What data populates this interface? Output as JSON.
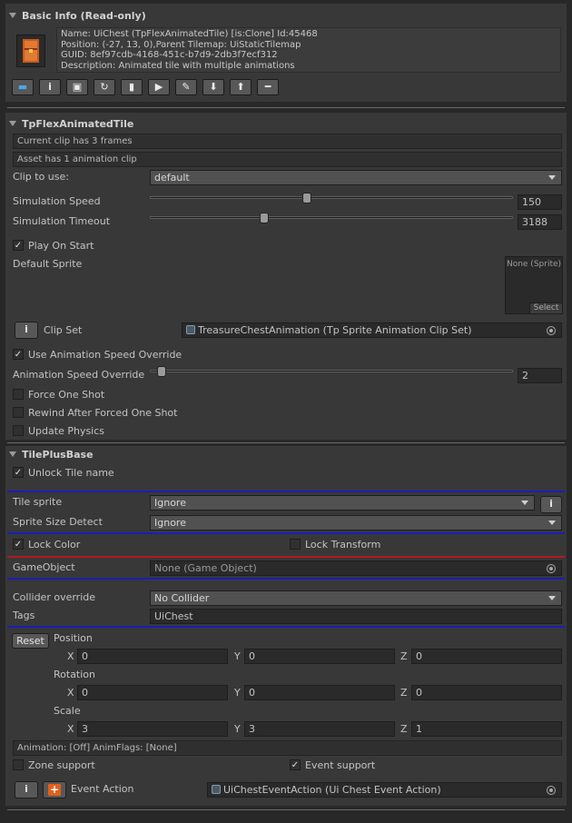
{
  "basic_info": {
    "title": "Basic Info (Read-only)",
    "name_line": "Name: UiChest (TpFlexAnimatedTile) [is:Clone] Id:45468",
    "position_line": "Position: (-27, 13, 0),Parent Tilemap: UiStaticTilemap",
    "guid_line": "GUID: 8ef97cdb-4168-451c-b7d9-2db3f7ecf312",
    "desc_line": "Description: Animated tile with multiple animations",
    "toolbar": [
      {
        "name": "camera-icon",
        "glyph": "▬"
      },
      {
        "name": "info-icon",
        "glyph": "i"
      },
      {
        "name": "save-icon",
        "glyph": "▣"
      },
      {
        "name": "refresh-icon",
        "glyph": "↻"
      },
      {
        "name": "clipboard-icon",
        "glyph": "▮"
      },
      {
        "name": "play-icon",
        "glyph": "▶"
      },
      {
        "name": "eyedropper-icon",
        "glyph": "✎"
      },
      {
        "name": "arrow-down-icon",
        "glyph": "⬇"
      },
      {
        "name": "arrow-up-icon",
        "glyph": "⬆"
      },
      {
        "name": "minus-icon",
        "glyph": "━"
      }
    ]
  },
  "flex": {
    "title": "TpFlexAnimatedTile",
    "info1": "Current clip has 3 frames",
    "info2": "Asset has 1 animation clip",
    "clip_label": "Clip to use:",
    "clip_value": "default",
    "sim_speed_label": "Simulation Speed",
    "sim_speed_value": "150",
    "sim_speed_fraction": 0.43,
    "sim_timeout_label": "Simulation Timeout",
    "sim_timeout_value": "3188",
    "sim_timeout_fraction": 0.31,
    "play_on_start": "Play On Start",
    "default_sprite_label": "Default Sprite",
    "sprite_none": "None (Sprite)",
    "sprite_select": "Select",
    "clip_set_label": "Clip Set",
    "clip_set_value": "TreasureChestAnimation (Tp Sprite Animation Clip Set)",
    "use_override": "Use Animation Speed Override",
    "anim_override_label": "Animation Speed Override",
    "anim_override_value": "2",
    "anim_override_fraction": 0.02,
    "force_one_shot": "Force One Shot",
    "rewind": "Rewind After Forced One Shot",
    "update_physics": "Update Physics"
  },
  "base": {
    "title": "TilePlusBase",
    "unlock_name": "Unlock Tile name",
    "tile_sprite_label": "Tile sprite",
    "tile_sprite_value": "Ignore",
    "size_detect_label": "Sprite Size Detect",
    "size_detect_value": "Ignore",
    "lock_color": "Lock Color",
    "lock_transform": "Lock Transform",
    "gameobject_label": "GameObject",
    "gameobject_value": "None (Game Object)",
    "collider_label": "Collider override",
    "collider_value": "No Collider",
    "tags_label": "Tags",
    "tags_value": "UiChest",
    "reset": "Reset",
    "position_label": "Position",
    "rotation_label": "Rotation",
    "scale_label": "Scale",
    "x": "X",
    "y": "Y",
    "z": "Z",
    "pos": [
      "0",
      "0",
      "0"
    ],
    "rot": [
      "0",
      "0",
      "0"
    ],
    "scl": [
      "3",
      "3",
      "1"
    ],
    "anim_flags": "Animation: [Off] AnimFlags: [None]",
    "zone_support": "Zone support",
    "event_support": "Event support",
    "event_action_label": "Event Action",
    "event_action_value": "UiChestEventAction (Ui Chest Event Action)"
  },
  "colors": {
    "background": "#282828",
    "panel": "#383838",
    "blue_line": "#1a1fb4",
    "red_line": "#b41a1a"
  }
}
